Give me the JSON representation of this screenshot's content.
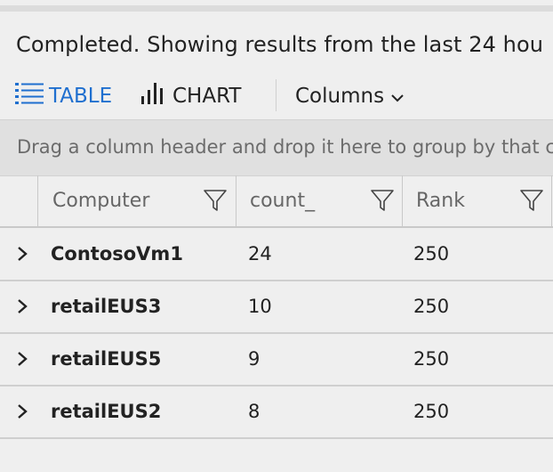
{
  "status": {
    "message": "Completed. Showing results from the last 24 hou"
  },
  "toolbar": {
    "table_label": "TABLE",
    "table_icon": "list-icon",
    "chart_label": "CHART",
    "chart_icon": "bar-chart-icon",
    "columns_label": "Columns",
    "columns_icon": "chevron-down-icon",
    "active_color": "#1f6fcf"
  },
  "group_bar": {
    "placeholder": "Drag a column header and drop it here to group by that c"
  },
  "grid": {
    "columns": [
      {
        "label": "Computer",
        "icon": "filter-icon"
      },
      {
        "label": "count_",
        "icon": "filter-icon"
      },
      {
        "label": "Rank",
        "icon": "filter-icon"
      }
    ],
    "rows": [
      {
        "computer": "ContosoVm1",
        "count": "24",
        "rank": "250"
      },
      {
        "computer": "retailEUS3",
        "count": "10",
        "rank": "250"
      },
      {
        "computer": "retailEUS5",
        "count": "9",
        "rank": "250"
      },
      {
        "computer": "retailEUS2",
        "count": "8",
        "rank": "250"
      }
    ]
  }
}
